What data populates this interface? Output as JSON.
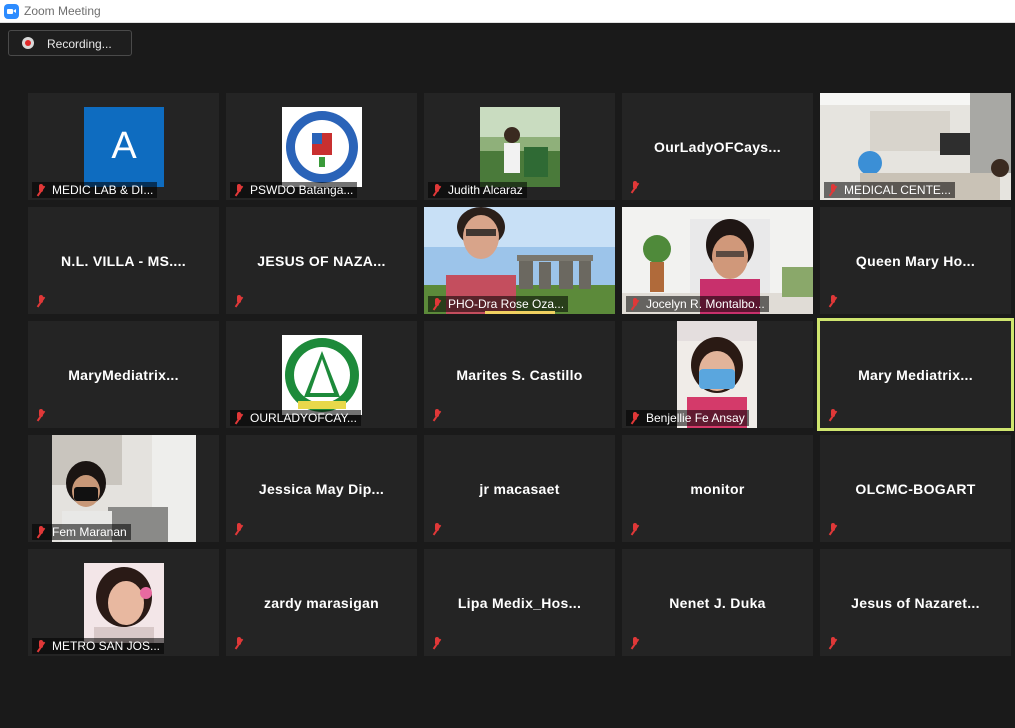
{
  "window": {
    "title": "Zoom Meeting"
  },
  "recording": {
    "label": "Recording..."
  },
  "participants": [
    {
      "id": "p1",
      "display": "avatar",
      "label": "MEDIC LAB & DI..."
    },
    {
      "id": "p2",
      "display": "logo",
      "label": "PSWDO Batanga..."
    },
    {
      "id": "p3",
      "display": "video",
      "label": "Judith Alcaraz"
    },
    {
      "id": "p4",
      "display": "name",
      "name": "OurLadyOFCays..."
    },
    {
      "id": "p5",
      "display": "video",
      "label": "MEDICAL CENTE..."
    },
    {
      "id": "p6",
      "display": "name",
      "name": "N.L. VILLA - MS...."
    },
    {
      "id": "p7",
      "display": "name",
      "name": "JESUS OF NAZA..."
    },
    {
      "id": "p8",
      "display": "video",
      "label": "PHO-Dra Rose Oza..."
    },
    {
      "id": "p9",
      "display": "video",
      "label": "Jocelyn R. Montalbo..."
    },
    {
      "id": "p10",
      "display": "name",
      "name": "Queen Mary Ho..."
    },
    {
      "id": "p11",
      "display": "name",
      "name": "MaryMediatrix..."
    },
    {
      "id": "p12",
      "display": "logo",
      "label": "OURLADYOFCAY..."
    },
    {
      "id": "p13",
      "display": "name",
      "name": "Marites S. Castillo"
    },
    {
      "id": "p14",
      "display": "video",
      "label": "Benjellie Fe Ansay"
    },
    {
      "id": "p15",
      "display": "name",
      "name": "Mary  Mediatrix...",
      "active": true
    },
    {
      "id": "p16",
      "display": "video",
      "label": "Fem Maranan"
    },
    {
      "id": "p17",
      "display": "name",
      "name": "Jessica May Dip..."
    },
    {
      "id": "p18",
      "display": "name",
      "name": "jr macasaet"
    },
    {
      "id": "p19",
      "display": "name",
      "name": "monitor"
    },
    {
      "id": "p20",
      "display": "name",
      "name": "OLCMC-BOGART"
    },
    {
      "id": "p21",
      "display": "photo",
      "label": "METRO SAN JOS..."
    },
    {
      "id": "p22",
      "display": "name",
      "name": "zardy marasigan"
    },
    {
      "id": "p23",
      "display": "name",
      "name": "Lipa  Medix_Hos..."
    },
    {
      "id": "p24",
      "display": "name",
      "name": "Nenet J. Duka"
    },
    {
      "id": "p25",
      "display": "name",
      "name": "Jesus of Nazaret..."
    }
  ],
  "avatar_letter": "A",
  "colors": {
    "accent": "#2d8cff",
    "active_border": "#cfe56f",
    "muted_mic": "#e03838",
    "record_dot": "#e02828"
  },
  "icons": {
    "mic_muted": "mic-muted-icon",
    "record": "record-icon",
    "app": "zoom-icon"
  }
}
